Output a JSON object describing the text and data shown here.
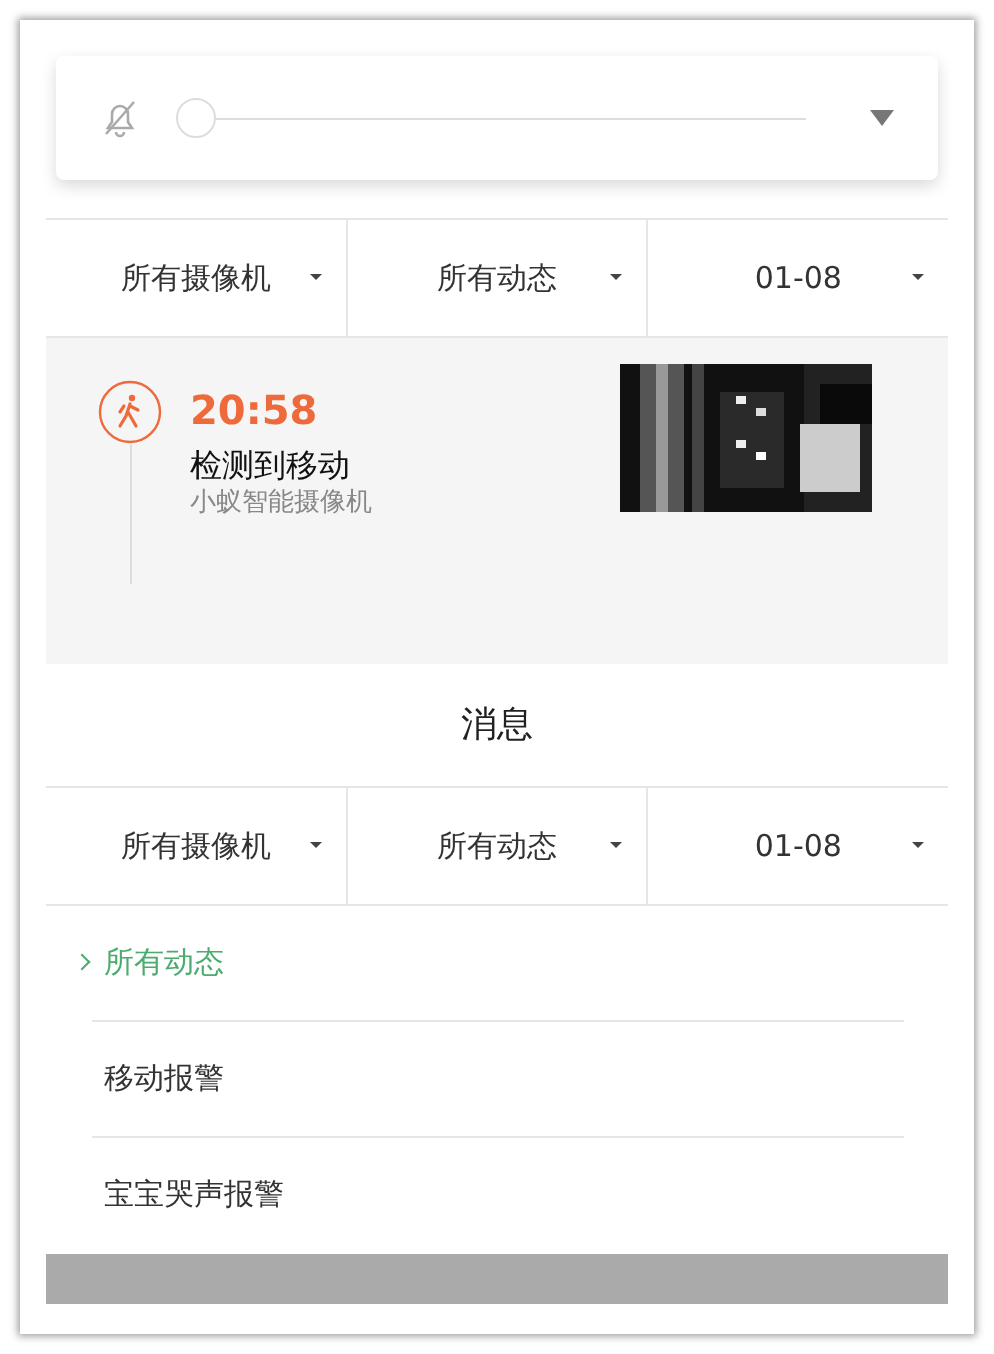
{
  "volume_panel": {
    "muted": true,
    "level": 0
  },
  "top_filters": [
    {
      "label": "所有摄像机"
    },
    {
      "label": "所有动态"
    },
    {
      "label": "01-08"
    }
  ],
  "event": {
    "kind": "motion",
    "time": "20:58",
    "title": "检测到移动",
    "camera": "小蚁智能摄像机"
  },
  "title": "消息",
  "filters": [
    {
      "label": "所有摄像机"
    },
    {
      "label": "所有动态"
    },
    {
      "label": "01-08"
    }
  ],
  "filter_options": [
    {
      "label": "所有动态",
      "selected": true
    },
    {
      "label": "移动报警",
      "selected": false
    },
    {
      "label": "宝宝哭声报警",
      "selected": false
    }
  ]
}
